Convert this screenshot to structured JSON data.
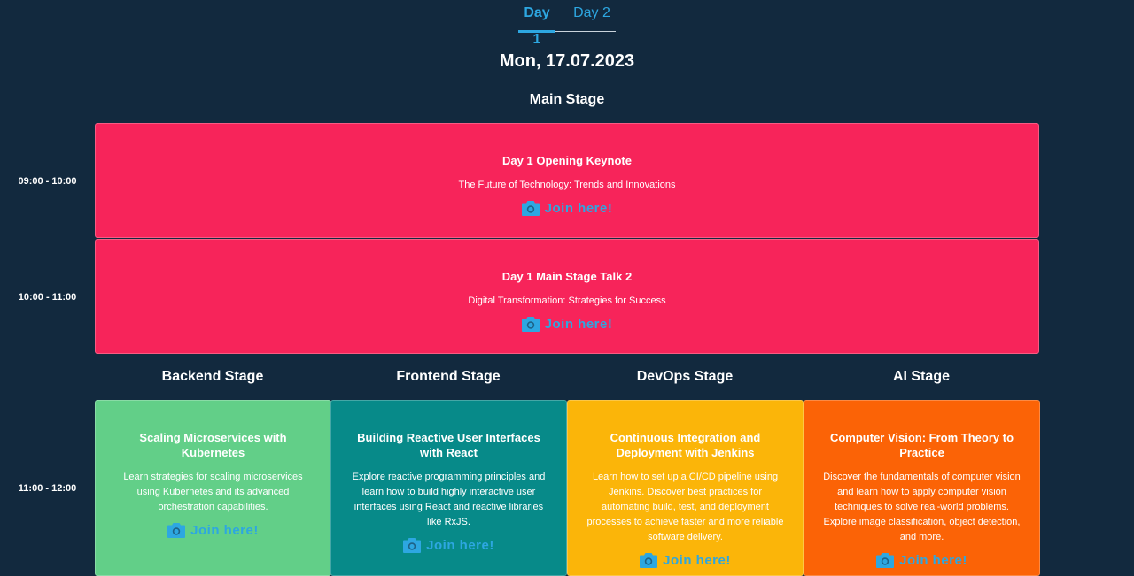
{
  "tabs": [
    {
      "label": "Day 1",
      "active": true
    },
    {
      "label": "Day 2",
      "active": false
    }
  ],
  "date": "Mon, 17.07.2023",
  "join_label": "Join here!",
  "colors": {
    "background": "#12293e",
    "accent": "#2da7e1",
    "main_stage": "#f7245a",
    "backend": "#62cf88",
    "frontend": "#078a89",
    "devops": "#fbb509",
    "ai": "#fb6306"
  },
  "main_stage": {
    "title": "Main Stage",
    "sessions": [
      {
        "time": "09:00 - 10:00",
        "title": "Day 1 Opening Keynote",
        "description": "The Future of Technology: Trends and Innovations",
        "join_icon": "camera-icon"
      },
      {
        "time": "10:00 - 11:00",
        "title": "Day 1 Main Stage Talk 2",
        "description": "Digital Transformation: Strategies for Success",
        "join_icon": "camera-icon"
      }
    ]
  },
  "tracks": {
    "time": "11:00 - 12:00",
    "stages": [
      {
        "name": "Backend Stage",
        "title": "Scaling Microservices with Kubernetes",
        "description": "Learn strategies for scaling microservices using Kubernetes and its advanced orchestration capabilities.",
        "join_icon": "camera-icon"
      },
      {
        "name": "Frontend Stage",
        "title": "Building Reactive User Interfaces with React",
        "description": "Explore reactive programming principles and learn how to build highly interactive user interfaces using React and reactive libraries like RxJS.",
        "join_icon": "camera-icon"
      },
      {
        "name": "DevOps Stage",
        "title": "Continuous Integration and Deployment with Jenkins",
        "description": "Learn how to set up a CI/CD pipeline using Jenkins. Discover best practices for automating build, test, and deployment processes to achieve faster and more reliable software delivery.",
        "join_icon": "camera-icon"
      },
      {
        "name": "AI Stage",
        "title": "Computer Vision: From Theory to Practice",
        "description": "Discover the fundamentals of computer vision and learn how to apply computer vision techniques to solve real-world problems. Explore image classification, object detection, and more.",
        "join_icon": "camera-icon"
      }
    ]
  }
}
